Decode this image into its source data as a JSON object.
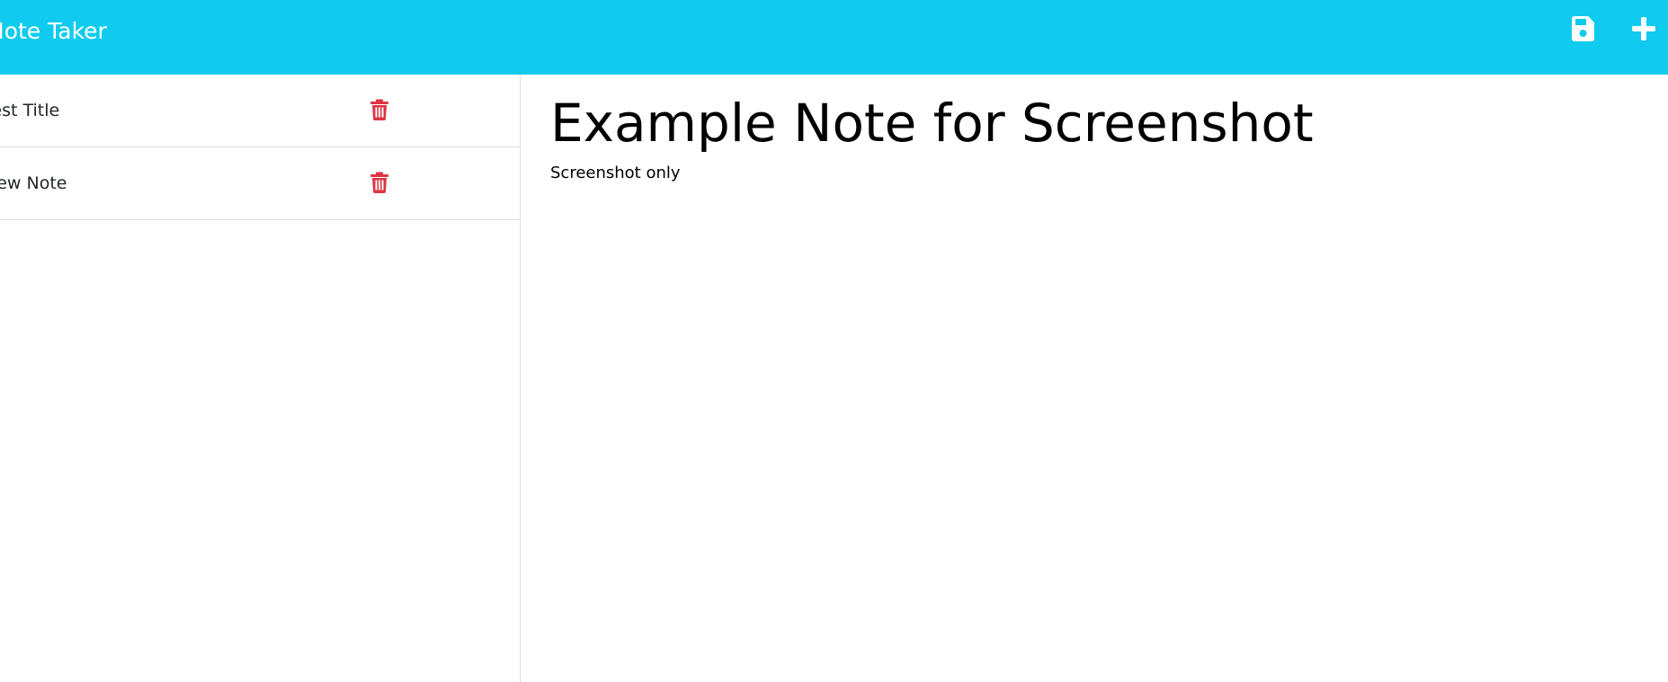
{
  "header": {
    "brand": "Note Taker",
    "save_icon": "save-icon",
    "add_icon": "plus-icon",
    "color": "#10cbef"
  },
  "sidebar": {
    "notes": [
      {
        "title": "Test Title",
        "delete_icon": "trash-icon"
      },
      {
        "title": "New Note",
        "delete_icon": "trash-icon"
      }
    ],
    "delete_color": "#dc3545"
  },
  "editor": {
    "title": "Example Note for Screenshot",
    "body": "Screenshot only"
  }
}
